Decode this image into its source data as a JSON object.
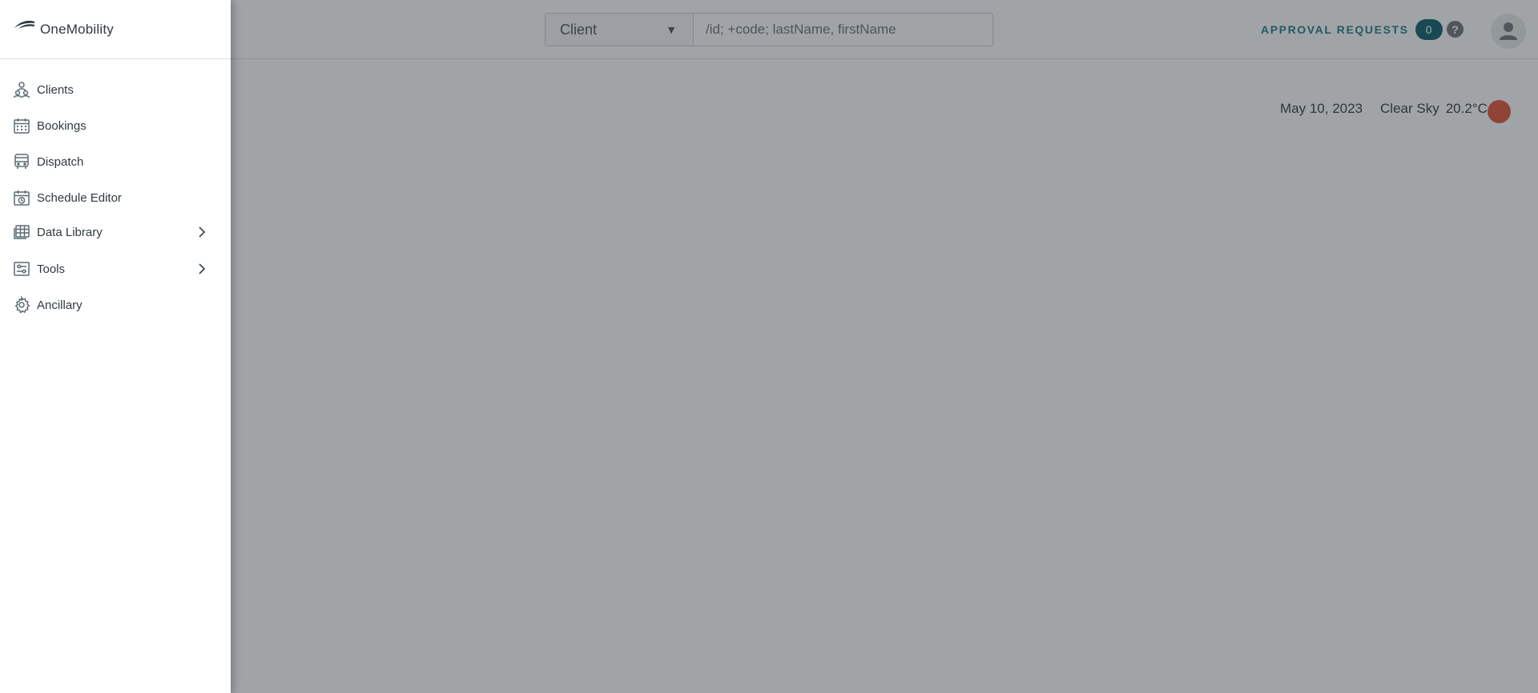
{
  "app": {
    "brand_name": "OneMobility"
  },
  "search": {
    "type_value": "Client",
    "placeholder": "/id; +code; lastName, firstName",
    "value": ""
  },
  "header": {
    "approval_label": "APPROVAL REQUESTS",
    "approval_count": "0",
    "help_glyph": "?"
  },
  "status": {
    "date": "May 10, 2023",
    "weather": "Clear Sky",
    "temperature": "20.2°C",
    "indicator_color": "#e0553a"
  },
  "sidebar": {
    "items": [
      {
        "label": "Clients",
        "icon": "clients-icon",
        "has_submenu": false
      },
      {
        "label": "Bookings",
        "icon": "calendar-icon",
        "has_submenu": false
      },
      {
        "label": "Dispatch",
        "icon": "bus-icon",
        "has_submenu": false
      },
      {
        "label": "Schedule Editor",
        "icon": "schedule-icon",
        "has_submenu": false
      },
      {
        "label": "Data Library",
        "icon": "library-icon",
        "has_submenu": true
      },
      {
        "label": "Tools",
        "icon": "tools-icon",
        "has_submenu": true
      },
      {
        "label": "Ancillary",
        "icon": "gear-icon",
        "has_submenu": false
      }
    ]
  },
  "colors": {
    "accent": "#1f7a86",
    "badge": "#0e5f6b",
    "icon": "#5b6b73"
  }
}
